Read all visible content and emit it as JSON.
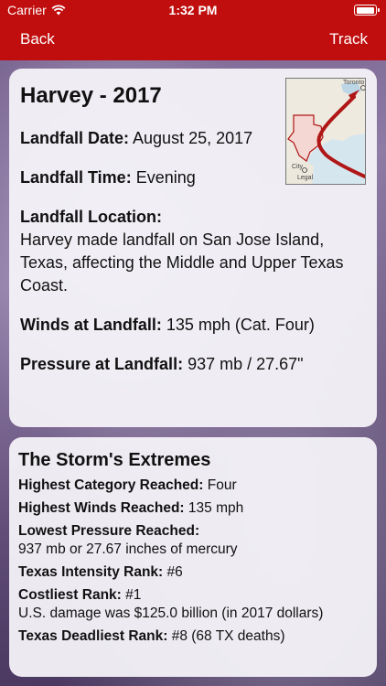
{
  "status": {
    "carrier": "Carrier",
    "time": "1:32 PM"
  },
  "nav": {
    "back_label": "Back",
    "track_label": "Track",
    "bar_color": "#c00d0d"
  },
  "storm": {
    "title": "Harvey - 2017",
    "landfall_date_label": "Landfall Date:",
    "landfall_date": "August 25, 2017",
    "landfall_time_label": "Landfall Time:",
    "landfall_time": "Evening",
    "landfall_location_label": "Landfall Location:",
    "landfall_location": "Harvey made landfall on San Jose Island, Texas, affecting the Middle and Upper Texas Coast.",
    "winds_label": "Winds at Landfall:",
    "winds": "135 mph (Cat. Four)",
    "pressure_label": "Pressure at Landfall:",
    "pressure": "937 mb / 27.67\""
  },
  "map_thumb": {
    "labels": [
      "Toronto",
      "City",
      "Legal"
    ],
    "track_color": "#b01616"
  },
  "extremes": {
    "title": "The Storm's Extremes",
    "highest_category_label": "Highest Category Reached:",
    "highest_category": "Four",
    "highest_winds_label": "Highest Winds Reached:",
    "highest_winds": "135 mph",
    "lowest_pressure_label": "Lowest Pressure Reached:",
    "lowest_pressure": "937 mb or 27.67 inches of mercury",
    "texas_intensity_label": "Texas Intensity Rank:",
    "texas_intensity": "#6",
    "costliest_label": "Costliest Rank:",
    "costliest": "#1",
    "costliest_detail": "U.S. damage was $125.0 billion (in 2017 dollars)",
    "texas_deadliest_label": "Texas Deadliest Rank:",
    "texas_deadliest": "#8 (68 TX deaths)"
  }
}
